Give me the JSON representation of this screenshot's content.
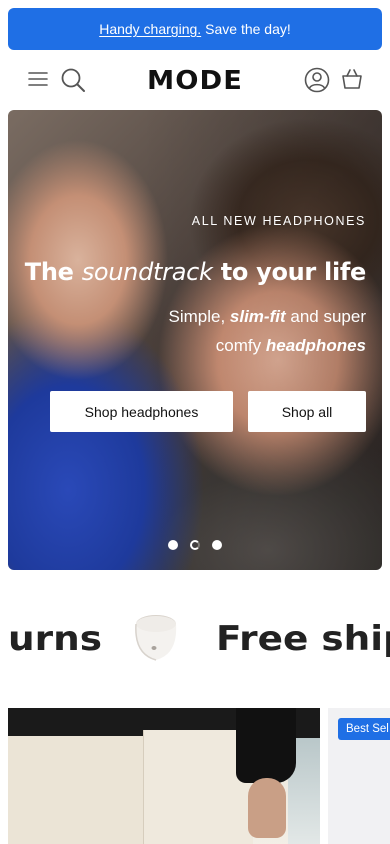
{
  "announcement": {
    "link_text": "Handy charging.",
    "text": "Save the day!"
  },
  "header": {
    "logo": "MODE",
    "icons": [
      "hamburger-menu-icon",
      "search-icon",
      "account-icon",
      "basket-icon"
    ]
  },
  "hero": {
    "eyebrow": "ALL NEW HEADPHONES",
    "title_pre": "The",
    "title_italic": "soundtrack",
    "title_post": "to your life",
    "sub_pre": "Simple,",
    "sub_bold1": "slim-fit",
    "sub_mid": "and super comfy",
    "sub_bold2": "headphones",
    "buttons": {
      "primary": "Shop headphones",
      "secondary": "Shop all"
    },
    "slides_total": 3,
    "slide_active": 2
  },
  "marquee": {
    "left_text": "urns",
    "right_text": "Free ship"
  },
  "products": {
    "card2_badge": "Best Sel"
  },
  "colors": {
    "accent": "#1f6fe5",
    "text": "#111111"
  }
}
